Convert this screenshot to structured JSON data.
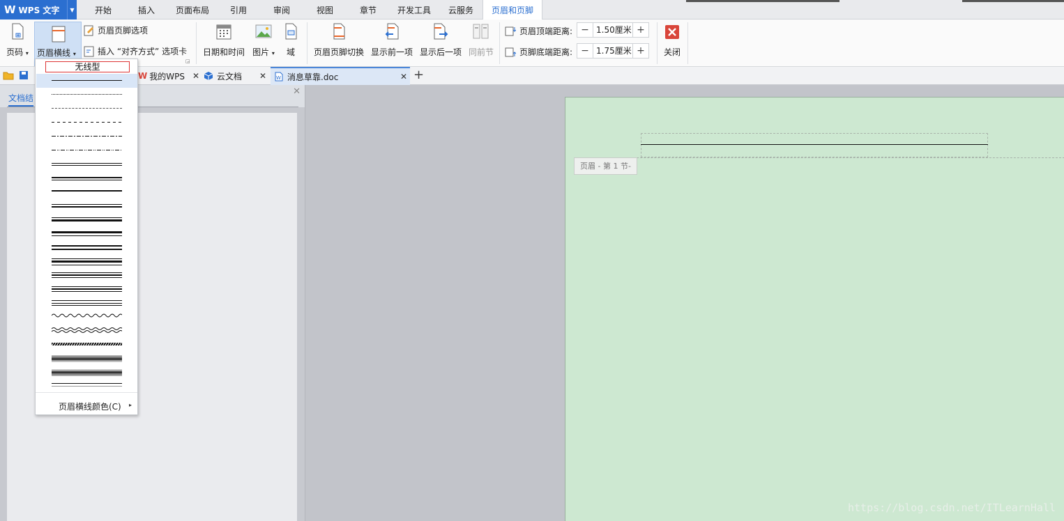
{
  "app": {
    "name": "WPS 文字"
  },
  "menu": {
    "tabs": [
      "开始",
      "插入",
      "页面布局",
      "引用",
      "审阅",
      "视图",
      "章节",
      "开发工具",
      "云服务",
      "页眉和页脚"
    ],
    "active": "页眉和页脚"
  },
  "ribbon": {
    "page_number": "页码",
    "header_line": "页眉横线",
    "hf_options": "页眉页脚选项",
    "insert_align_tab": "插入 “对齐方式” 选项卡",
    "date_time": "日期和时间",
    "picture": "图片",
    "field": "域",
    "hf_switch": "页眉页脚切换",
    "show_prev": "显示前一项",
    "show_next": "显示后一项",
    "same_as_prev": "同前节",
    "header_top_label": "页眉顶端距离:",
    "header_top_value": "1.50厘米",
    "footer_bottom_label": "页脚底端距离:",
    "footer_bottom_value": "1.75厘米",
    "close": "关闭"
  },
  "doc_tabs": [
    {
      "label": "我的WPS"
    },
    {
      "label": "云文档"
    },
    {
      "label": "消息草靠.doc"
    }
  ],
  "nav_panel": {
    "title": "文档结"
  },
  "document": {
    "header_tag": "页眉  - 第 1 节-",
    "watermark": "https://blog.csdn.net/ITLearnHall"
  },
  "dropdown": {
    "no_line": "无线型",
    "color_option": "页眉横线颜色(C)"
  }
}
